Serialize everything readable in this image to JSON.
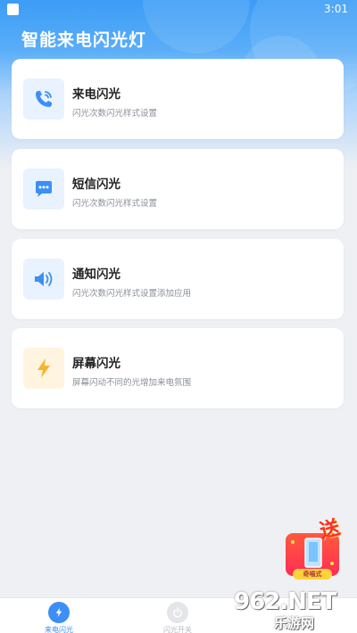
{
  "status_bar": {
    "time": "3:01"
  },
  "app": {
    "title": "智能来电闪光灯"
  },
  "cards": [
    {
      "title": "来电闪光",
      "desc": "闪光次数闪光样式设置",
      "icon": "phone-icon",
      "icon_color": "#3d8ff5",
      "icon_bg": "#e8f3ff"
    },
    {
      "title": "短信闪光",
      "desc": "闪光次数闪光样式设置",
      "icon": "message-icon",
      "icon_color": "#3d8ff5",
      "icon_bg": "#e8f3ff"
    },
    {
      "title": "通知闪光",
      "desc": "闪光次数闪光样式设置添加应用",
      "icon": "speaker-icon",
      "icon_color": "#3d8ff5",
      "icon_bg": "#e8f3ff"
    },
    {
      "title": "屏幕闪光",
      "desc": "屏幕闪动不同的光增加来电氛围",
      "icon": "lightning-icon",
      "icon_color": "#f5b52a",
      "icon_bg": "#fff4df"
    }
  ],
  "bottom_nav": [
    {
      "label": "来电闪光",
      "icon": "lightning-icon",
      "active": true,
      "color": "#3d8ff5"
    },
    {
      "label": "闪光开关",
      "icon": "power-icon",
      "active": false,
      "color": "#b5b8bd"
    }
  ],
  "promo": {
    "send_text": "送",
    "label": "奇喵式"
  },
  "watermark": {
    "site": "962.NET",
    "name": "乐游网"
  }
}
